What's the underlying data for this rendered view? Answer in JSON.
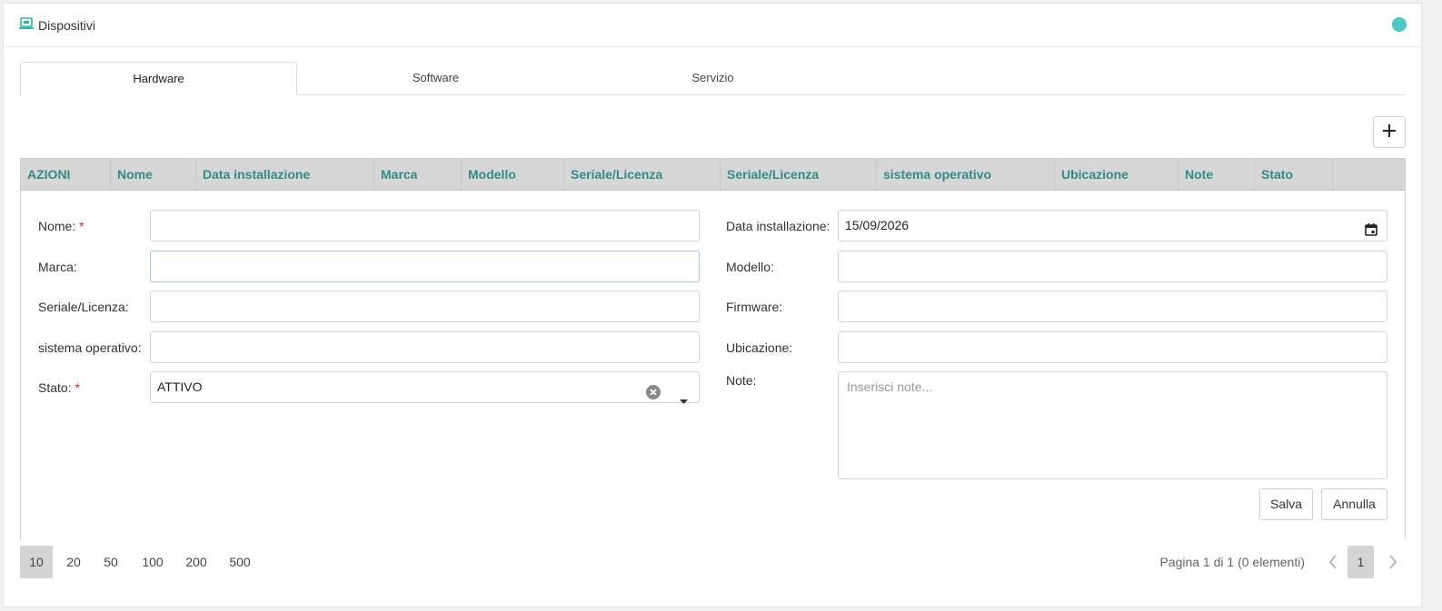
{
  "header": {
    "title": "Dispositivi",
    "icon": "laptop-icon",
    "status_color": "#4ac9c2"
  },
  "tabs": [
    {
      "label": "Hardware",
      "active": true
    },
    {
      "label": "Software",
      "active": false
    },
    {
      "label": "Servizio",
      "active": false
    }
  ],
  "grid": {
    "columns": [
      "AZIONI",
      "Nome",
      "Data installazione",
      "Marca",
      "Modello",
      "Seriale/Licenza",
      "Seriale/Licenza",
      "sistema operativo",
      "Ubicazione",
      "Note",
      "Stato"
    ],
    "header_color": "#2f8c86"
  },
  "form": {
    "nome_label": "Nome:",
    "nome_value": "",
    "marca_label": "Marca:",
    "marca_value": "",
    "seriale_label": "Seriale/Licenza:",
    "seriale_value": "",
    "sistema_label": "sistema operativo:",
    "sistema_value": "",
    "stato_label": "Stato:",
    "stato_value": "ATTIVO",
    "required_mark": "*",
    "data_label": "Data installazione:",
    "data_value": "15/09/2026",
    "modello_label": "Modello:",
    "modello_value": "",
    "firmware_label": "Firmware:",
    "firmware_value": "",
    "ubicazione_label": "Ubicazione:",
    "ubicazione_value": "",
    "note_label": "Note:",
    "note_placeholder": "Inserisci note...",
    "save_label": "Salva",
    "cancel_label": "Annulla"
  },
  "pager": {
    "sizes": [
      "10",
      "20",
      "50",
      "100",
      "200",
      "500"
    ],
    "active_size": "10",
    "info": "Pagina 1 di 1 (0 elementi)",
    "current_page": "1"
  }
}
